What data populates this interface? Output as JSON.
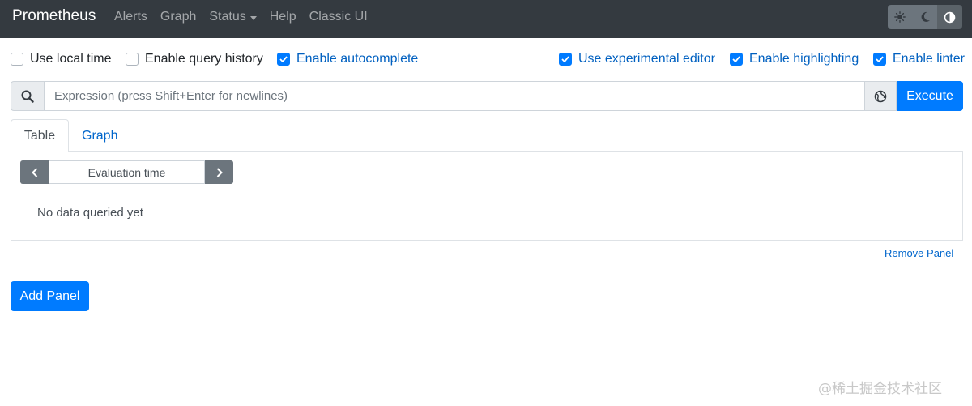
{
  "navbar": {
    "brand": "Prometheus",
    "links": [
      {
        "label": "Alerts"
      },
      {
        "label": "Graph"
      },
      {
        "label": "Status"
      },
      {
        "label": "Help"
      },
      {
        "label": "Classic UI"
      }
    ],
    "theme_icons": [
      "sun-icon",
      "moon-icon",
      "half-circle-icon"
    ],
    "active_theme": "half-circle-icon",
    "background": "#343a40"
  },
  "options": {
    "use_local_time": {
      "label": "Use local time",
      "checked": false
    },
    "enable_query_history": {
      "label": "Enable query history",
      "checked": false
    },
    "enable_autocomplete": {
      "label": "Enable autocomplete",
      "checked": true
    },
    "use_experimental_editor": {
      "label": "Use experimental editor",
      "checked": true
    },
    "enable_highlighting": {
      "label": "Enable highlighting",
      "checked": true
    },
    "enable_linter": {
      "label": "Enable linter",
      "checked": true
    }
  },
  "expression": {
    "placeholder": "Expression (press Shift+Enter for newlines)",
    "value": "",
    "execute_label": "Execute"
  },
  "panel": {
    "tabs": [
      {
        "label": "Table",
        "active": true
      },
      {
        "label": "Graph",
        "active": false
      }
    ],
    "evaluation_time_placeholder": "Evaluation time",
    "no_data_text": "No data queried yet",
    "remove_label": "Remove Panel"
  },
  "add_panel_label": "Add Panel",
  "watermark": "@稀土掘金技术社区",
  "colors": {
    "accent": "#007bff",
    "link": "#0066cc",
    "secondary": "#6c757d"
  }
}
